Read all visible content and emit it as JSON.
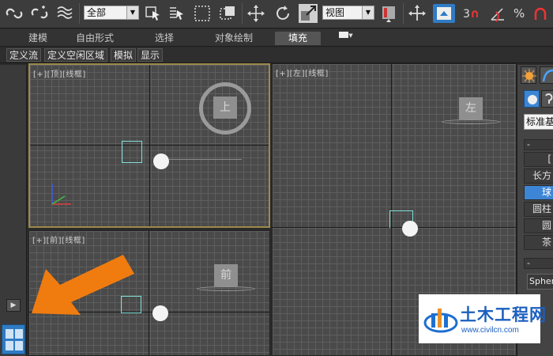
{
  "toolbar": {
    "selection_filter": "全部",
    "reference_coord": "视图",
    "snap_label": "3",
    "percent_label": "%"
  },
  "ribbon": {
    "tabs": [
      "建模",
      "自由形式",
      "选择",
      "对象绘制",
      "填充"
    ],
    "active_tab": "填充"
  },
  "subribbon": {
    "buttons": [
      "定义流",
      "定义空闲区域",
      "模拟",
      "显示"
    ]
  },
  "viewports": {
    "top": {
      "label": "[+][顶][线框]",
      "gizmo": "上"
    },
    "left": {
      "label": "[+][左][线框]",
      "gizmo": "左"
    },
    "front": {
      "label": "[+][前][线框]",
      "gizmo": "前"
    }
  },
  "command_panel": {
    "dropdown": "标准基",
    "minus": "-",
    "rows": [
      "[",
      "长方",
      "球",
      "圆柱",
      "圆",
      "茶"
    ],
    "selected_row": "球",
    "name_field": "Sphere",
    "minus2": "-"
  },
  "watermark": {
    "title": "土木工程网",
    "url": "www.civilcn.com"
  },
  "colors": {
    "accent": "#2f7bc4",
    "active_viewport_border": "#9c8a4a",
    "arrow": "#f07c10"
  }
}
